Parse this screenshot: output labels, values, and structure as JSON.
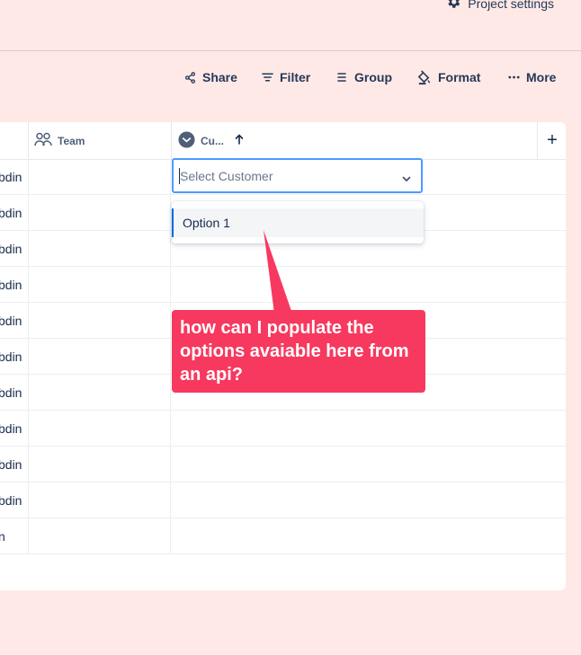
{
  "header": {
    "project_settings_label": "Project settings"
  },
  "toolbar": {
    "share_label": "Share",
    "filter_label": "Filter",
    "group_label": "Group",
    "format_label": "Format",
    "more_label": "More"
  },
  "table": {
    "columns": {
      "team_label": "Team",
      "customer_label": "Cu..."
    },
    "add_column_label": "+",
    "rows": [
      {
        "name": "bdin"
      },
      {
        "name": "bdin"
      },
      {
        "name": "bdin"
      },
      {
        "name": "bdin"
      },
      {
        "name": "bdin"
      },
      {
        "name": "bdin"
      },
      {
        "name": "bdin"
      },
      {
        "name": "bdin"
      },
      {
        "name": "bdin"
      },
      {
        "name": "bdin"
      },
      {
        "name": "n"
      }
    ]
  },
  "customer_select": {
    "placeholder": "Select Customer",
    "options": [
      "Option 1"
    ]
  },
  "annotation": {
    "text": "how can I populate the options avaiable here from an api?",
    "color": "#f7395f"
  },
  "colors": {
    "background": "#ffe9e6",
    "focus": "#4c9aff",
    "selected_accent": "#0c66e4"
  }
}
